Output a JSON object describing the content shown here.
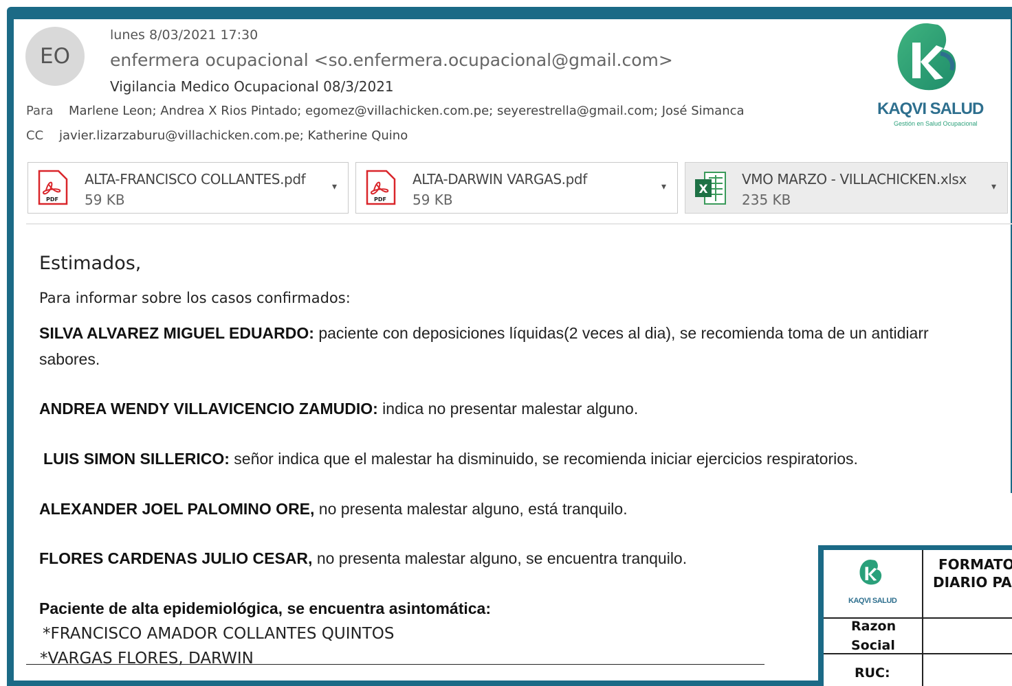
{
  "header": {
    "avatar_initials": "EO",
    "date": "lunes 8/03/2021 17:30",
    "sender": "enfermera ocupacional <so.enfermera.ocupacional@gmail.com>",
    "subject": "Vigilancia Medico Ocupacional 08/3/2021",
    "to_label": "Para",
    "to_value": "Marlene Leon; Andrea X Rios Pintado; egomez@villachicken.com.pe; seyerestrella@gmail.com; José Simanca",
    "cc_label": "CC",
    "cc_value": "javier.lizarzaburu@villachicken.com.pe; Katherine Quino"
  },
  "logo": {
    "name": "KAQVI SALUD",
    "tagline": "Gestión en Salud Ocupacional",
    "brand_colors": {
      "green": "#2aa07a",
      "blue": "#2e6f8e"
    }
  },
  "attachments": [
    {
      "name": "ALTA-FRANCISCO COLLANTES.pdf",
      "size": "59 KB",
      "icon": "pdf-icon"
    },
    {
      "name": "ALTA-DARWIN VARGAS.pdf",
      "size": "59 KB",
      "icon": "pdf-icon"
    },
    {
      "name": "VMO MARZO - VILLACHICKEN.xlsx",
      "size": "235 KB",
      "icon": "excel-icon"
    }
  ],
  "body": {
    "greeting": "Estimados,",
    "intro": "Para informar sobre los casos confirmados:",
    "cases": [
      {
        "name": "SILVA ALVAREZ MIGUEL EDUARDO:",
        "text": " paciente con deposiciones líquidas(2 veces al dia), se recomienda toma de un antidiarr",
        "continuation": "sabores."
      },
      {
        "name": "ANDREA WENDY VILLAVICENCIO ZAMUDIO:",
        "text": " indica no presentar malestar alguno."
      },
      {
        "name": "LUIS SIMON SILLERICO:",
        "text": " señor indica que el malestar ha disminuido, se recomienda iniciar ejercicios respiratorios."
      },
      {
        "name": "ALEXANDER JOEL PALOMINO ORE,",
        "text": " no presenta malestar alguno, está tranquilo."
      },
      {
        "name": "FLORES CARDENAS JULIO CESAR,",
        "text": " no presenta malestar alguno, se encuentra tranquilo."
      }
    ],
    "discharge_heading": "Paciente de alta epidemiológica, se encuentra asintomática:",
    "discharge_list": [
      "*FRANCISCO AMADOR COLLANTES QUINTOS",
      "*VARGAS FLORES, DARWIN"
    ]
  },
  "inset_form": {
    "logo_name": "KAQVI SALUD",
    "title_line1": "FORMATO",
    "title_line2": "DIARIO PA",
    "razon_label_1": "Razon",
    "razon_label_2": "Social",
    "ruc_label": "RUC:"
  }
}
